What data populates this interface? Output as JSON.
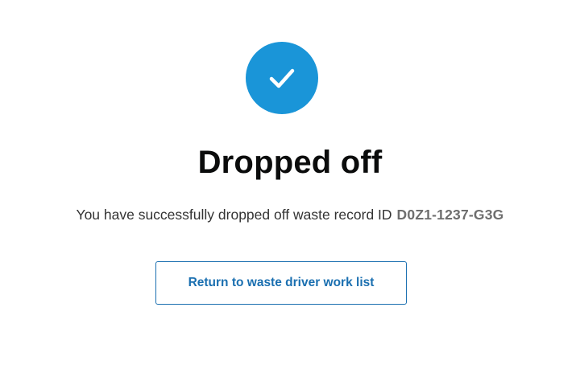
{
  "status_icon": "check-icon",
  "accent_color": "#1a95d8",
  "title": "Dropped off",
  "message": {
    "text": "You have successfully dropped off waste record ID",
    "record_id": "D0Z1-1237-G3G"
  },
  "actions": {
    "return_label": "Return to waste driver work list"
  }
}
